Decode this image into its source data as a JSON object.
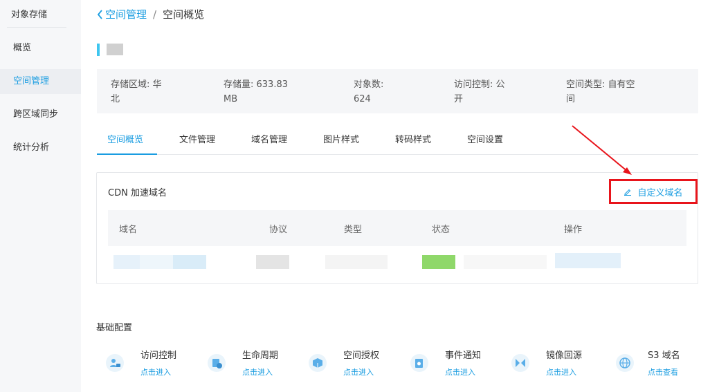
{
  "sidebar": {
    "title": "对象存储",
    "items": [
      {
        "label": "概览"
      },
      {
        "label": "空间管理"
      },
      {
        "label": "跨区域同步"
      },
      {
        "label": "统计分析"
      }
    ]
  },
  "breadcrumb": {
    "back_label": "空间管理",
    "separator": "/",
    "current": "空间概览"
  },
  "info": [
    {
      "line1": "存储区域:  华",
      "line2": "北"
    },
    {
      "line1": "存储量:  633.83",
      "line2": "MB"
    },
    {
      "line1": "对象数:",
      "line2": "624"
    },
    {
      "line1": "访问控制:  公",
      "line2": "开"
    },
    {
      "line1": "空间类型:  自有空",
      "line2": "间"
    }
  ],
  "tabs": [
    {
      "label": "空间概览"
    },
    {
      "label": "文件管理"
    },
    {
      "label": "域名管理"
    },
    {
      "label": "图片样式"
    },
    {
      "label": "转码样式"
    },
    {
      "label": "空间设置"
    }
  ],
  "cdn": {
    "title": "CDN 加速域名",
    "custom_domain_label": "自定义域名",
    "columns": [
      "域名",
      "协议",
      "类型",
      "状态",
      "操作"
    ]
  },
  "basic": {
    "title": "基础配置",
    "items": [
      {
        "name": "访问控制",
        "link": "点击进入",
        "icon": "user-lock-icon"
      },
      {
        "name": "生命周期",
        "link": "点击进入",
        "icon": "lifecycle-icon"
      },
      {
        "name": "空间授权",
        "link": "点击进入",
        "icon": "box-auth-icon"
      },
      {
        "name": "事件通知",
        "link": "点击进入",
        "icon": "event-notify-icon"
      },
      {
        "name": "镜像回源",
        "link": "点击进入",
        "icon": "mirror-icon"
      },
      {
        "name": "S3 域名",
        "link": "点击查看",
        "icon": "globe-icon"
      }
    ]
  },
  "colors": {
    "accent": "#1a9de1",
    "highlight_red": "#e8141b",
    "status_green": "#8fd86a"
  }
}
